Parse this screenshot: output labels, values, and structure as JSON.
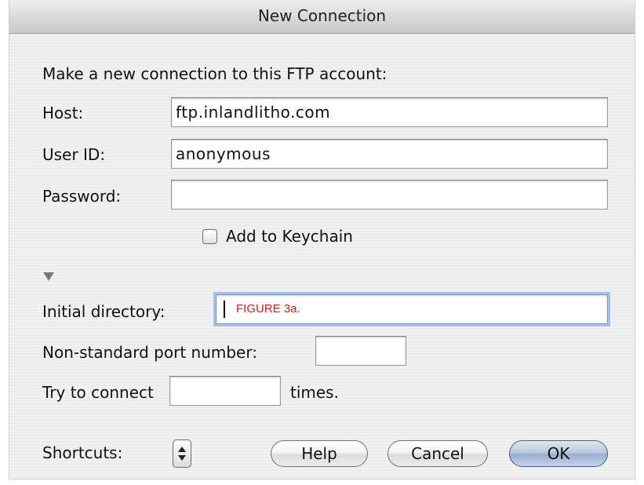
{
  "dialog": {
    "title": "New Connection",
    "intro": "Make a new connection to this FTP account:"
  },
  "fields": {
    "host": {
      "label": "Host:",
      "value": "ftp.inlandlitho.com"
    },
    "user_id": {
      "label": "User ID:",
      "value": "anonymous"
    },
    "password": {
      "label": "Password:",
      "value": ""
    },
    "keychain": {
      "label": "Add to Keychain",
      "checked": false
    },
    "initial_directory": {
      "label": "Initial directory:",
      "value": ""
    },
    "port": {
      "label": "Non-standard port number:",
      "value": ""
    },
    "retries": {
      "label_before": "Try to connect",
      "label_after": "times.",
      "value": ""
    }
  },
  "annotation": {
    "text": "FIGURE 3a.",
    "color": "#d81b1b"
  },
  "footer": {
    "shortcuts_label": "Shortcuts:",
    "help_label": "Help",
    "cancel_label": "Cancel",
    "ok_label": "OK"
  },
  "icons": {
    "disclosure": "disclosure-triangle-down-icon",
    "stepper": "up-down-stepper-icon"
  }
}
